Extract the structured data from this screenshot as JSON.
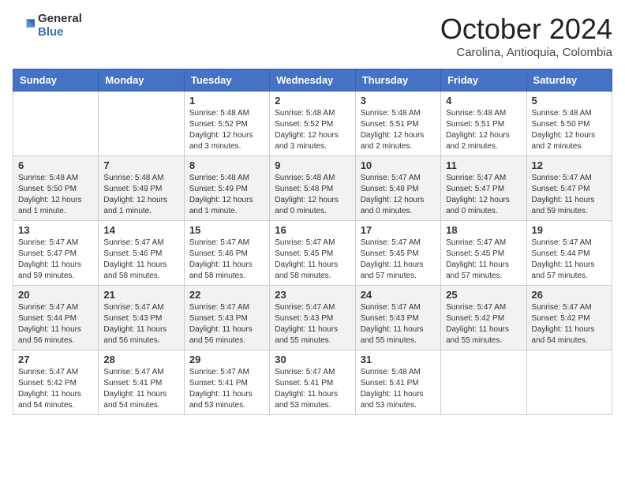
{
  "logo": {
    "general": "General",
    "blue": "Blue"
  },
  "title": "October 2024",
  "subtitle": "Carolina, Antioquia, Colombia",
  "days_of_week": [
    "Sunday",
    "Monday",
    "Tuesday",
    "Wednesday",
    "Thursday",
    "Friday",
    "Saturday"
  ],
  "weeks": [
    [
      {
        "day": null
      },
      {
        "day": null
      },
      {
        "day": 1,
        "sunrise": "Sunrise: 5:48 AM",
        "sunset": "Sunset: 5:52 PM",
        "daylight": "Daylight: 12 hours and 3 minutes."
      },
      {
        "day": 2,
        "sunrise": "Sunrise: 5:48 AM",
        "sunset": "Sunset: 5:52 PM",
        "daylight": "Daylight: 12 hours and 3 minutes."
      },
      {
        "day": 3,
        "sunrise": "Sunrise: 5:48 AM",
        "sunset": "Sunset: 5:51 PM",
        "daylight": "Daylight: 12 hours and 2 minutes."
      },
      {
        "day": 4,
        "sunrise": "Sunrise: 5:48 AM",
        "sunset": "Sunset: 5:51 PM",
        "daylight": "Daylight: 12 hours and 2 minutes."
      },
      {
        "day": 5,
        "sunrise": "Sunrise: 5:48 AM",
        "sunset": "Sunset: 5:50 PM",
        "daylight": "Daylight: 12 hours and 2 minutes."
      }
    ],
    [
      {
        "day": 6,
        "sunrise": "Sunrise: 5:48 AM",
        "sunset": "Sunset: 5:50 PM",
        "daylight": "Daylight: 12 hours and 1 minute."
      },
      {
        "day": 7,
        "sunrise": "Sunrise: 5:48 AM",
        "sunset": "Sunset: 5:49 PM",
        "daylight": "Daylight: 12 hours and 1 minute."
      },
      {
        "day": 8,
        "sunrise": "Sunrise: 5:48 AM",
        "sunset": "Sunset: 5:49 PM",
        "daylight": "Daylight: 12 hours and 1 minute."
      },
      {
        "day": 9,
        "sunrise": "Sunrise: 5:48 AM",
        "sunset": "Sunset: 5:48 PM",
        "daylight": "Daylight: 12 hours and 0 minutes."
      },
      {
        "day": 10,
        "sunrise": "Sunrise: 5:47 AM",
        "sunset": "Sunset: 5:48 PM",
        "daylight": "Daylight: 12 hours and 0 minutes."
      },
      {
        "day": 11,
        "sunrise": "Sunrise: 5:47 AM",
        "sunset": "Sunset: 5:47 PM",
        "daylight": "Daylight: 12 hours and 0 minutes."
      },
      {
        "day": 12,
        "sunrise": "Sunrise: 5:47 AM",
        "sunset": "Sunset: 5:47 PM",
        "daylight": "Daylight: 11 hours and 59 minutes."
      }
    ],
    [
      {
        "day": 13,
        "sunrise": "Sunrise: 5:47 AM",
        "sunset": "Sunset: 5:47 PM",
        "daylight": "Daylight: 11 hours and 59 minutes."
      },
      {
        "day": 14,
        "sunrise": "Sunrise: 5:47 AM",
        "sunset": "Sunset: 5:46 PM",
        "daylight": "Daylight: 11 hours and 58 minutes."
      },
      {
        "day": 15,
        "sunrise": "Sunrise: 5:47 AM",
        "sunset": "Sunset: 5:46 PM",
        "daylight": "Daylight: 11 hours and 58 minutes."
      },
      {
        "day": 16,
        "sunrise": "Sunrise: 5:47 AM",
        "sunset": "Sunset: 5:45 PM",
        "daylight": "Daylight: 11 hours and 58 minutes."
      },
      {
        "day": 17,
        "sunrise": "Sunrise: 5:47 AM",
        "sunset": "Sunset: 5:45 PM",
        "daylight": "Daylight: 11 hours and 57 minutes."
      },
      {
        "day": 18,
        "sunrise": "Sunrise: 5:47 AM",
        "sunset": "Sunset: 5:45 PM",
        "daylight": "Daylight: 11 hours and 57 minutes."
      },
      {
        "day": 19,
        "sunrise": "Sunrise: 5:47 AM",
        "sunset": "Sunset: 5:44 PM",
        "daylight": "Daylight: 11 hours and 57 minutes."
      }
    ],
    [
      {
        "day": 20,
        "sunrise": "Sunrise: 5:47 AM",
        "sunset": "Sunset: 5:44 PM",
        "daylight": "Daylight: 11 hours and 56 minutes."
      },
      {
        "day": 21,
        "sunrise": "Sunrise: 5:47 AM",
        "sunset": "Sunset: 5:43 PM",
        "daylight": "Daylight: 11 hours and 56 minutes."
      },
      {
        "day": 22,
        "sunrise": "Sunrise: 5:47 AM",
        "sunset": "Sunset: 5:43 PM",
        "daylight": "Daylight: 11 hours and 56 minutes."
      },
      {
        "day": 23,
        "sunrise": "Sunrise: 5:47 AM",
        "sunset": "Sunset: 5:43 PM",
        "daylight": "Daylight: 11 hours and 55 minutes."
      },
      {
        "day": 24,
        "sunrise": "Sunrise: 5:47 AM",
        "sunset": "Sunset: 5:43 PM",
        "daylight": "Daylight: 11 hours and 55 minutes."
      },
      {
        "day": 25,
        "sunrise": "Sunrise: 5:47 AM",
        "sunset": "Sunset: 5:42 PM",
        "daylight": "Daylight: 11 hours and 55 minutes."
      },
      {
        "day": 26,
        "sunrise": "Sunrise: 5:47 AM",
        "sunset": "Sunset: 5:42 PM",
        "daylight": "Daylight: 11 hours and 54 minutes."
      }
    ],
    [
      {
        "day": 27,
        "sunrise": "Sunrise: 5:47 AM",
        "sunset": "Sunset: 5:42 PM",
        "daylight": "Daylight: 11 hours and 54 minutes."
      },
      {
        "day": 28,
        "sunrise": "Sunrise: 5:47 AM",
        "sunset": "Sunset: 5:41 PM",
        "daylight": "Daylight: 11 hours and 54 minutes."
      },
      {
        "day": 29,
        "sunrise": "Sunrise: 5:47 AM",
        "sunset": "Sunset: 5:41 PM",
        "daylight": "Daylight: 11 hours and 53 minutes."
      },
      {
        "day": 30,
        "sunrise": "Sunrise: 5:47 AM",
        "sunset": "Sunset: 5:41 PM",
        "daylight": "Daylight: 11 hours and 53 minutes."
      },
      {
        "day": 31,
        "sunrise": "Sunrise: 5:48 AM",
        "sunset": "Sunset: 5:41 PM",
        "daylight": "Daylight: 11 hours and 53 minutes."
      },
      {
        "day": null
      },
      {
        "day": null
      }
    ]
  ]
}
